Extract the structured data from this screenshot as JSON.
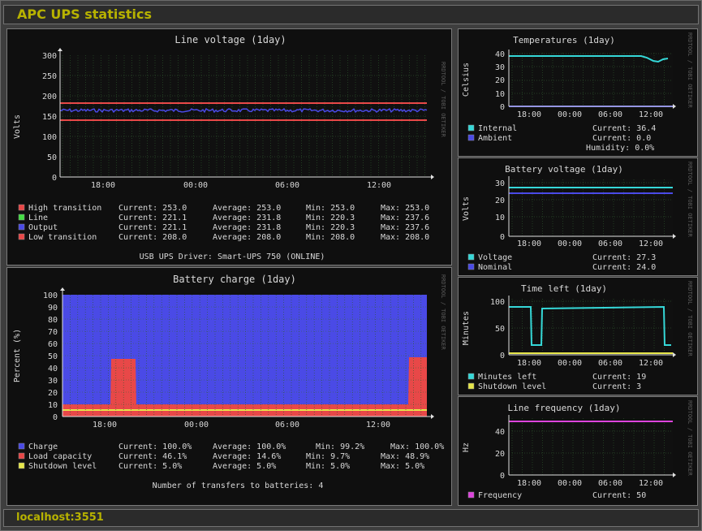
{
  "app": {
    "title": "APC UPS statistics",
    "host": "localhost:3551"
  },
  "watermark": "RRDTOOL / TOBI OETIKER",
  "colors": {
    "red": "#e84848",
    "green": "#44dd44",
    "blue": "#4a4ae6",
    "cyan": "#35d8d8",
    "yellow": "#e6e64a",
    "magenta": "#dd44dd",
    "bg": "#101010",
    "grid": "#2e5a2e"
  },
  "graphs": {
    "line_voltage": {
      "title": "Line voltage  (1day)",
      "ylabel": "Volts",
      "yticks": [
        "300",
        "250",
        "200",
        "150",
        "100",
        "50",
        "0"
      ],
      "xticks": [
        "18:00",
        "00:00",
        "06:00",
        "12:00"
      ],
      "legend": [
        {
          "name": "High transition",
          "color": "red",
          "current": "Current: 253.0",
          "average": "Average: 253.0",
          "min": "Min: 253.0",
          "max": "Max: 253.0"
        },
        {
          "name": "Line",
          "color": "green",
          "current": "Current: 221.1",
          "average": "Average: 231.8",
          "min": "Min: 220.3",
          "max": "Max: 237.6"
        },
        {
          "name": "Output",
          "color": "blue",
          "current": "Current: 221.1",
          "average": "Average: 231.8",
          "min": "Min: 220.3",
          "max": "Max: 237.6"
        },
        {
          "name": "Low transition",
          "color": "red",
          "current": "Current: 208.0",
          "average": "Average: 208.0",
          "min": "Min: 208.0",
          "max": "Max: 208.0"
        }
      ],
      "footer": "USB UPS Driver: Smart-UPS 750 (ONLINE)"
    },
    "battery_charge": {
      "title": "Battery charge  (1day)",
      "ylabel": "Percent (%)",
      "yticks": [
        "100",
        "90",
        "80",
        "70",
        "60",
        "50",
        "40",
        "30",
        "20",
        "10",
        "0"
      ],
      "xticks": [
        "18:00",
        "00:00",
        "06:00",
        "12:00"
      ],
      "legend": [
        {
          "name": "Charge",
          "color": "blue",
          "current": "Current: 100.0%",
          "average": "Average: 100.0%",
          "min": "Min: 99.2%",
          "max": "Max: 100.0%"
        },
        {
          "name": "Load capacity",
          "color": "red",
          "current": "Current: 46.1%",
          "average": "Average: 14.6%",
          "min": "Min:  9.7%",
          "max": "Max: 48.9%"
        },
        {
          "name": "Shutdown level",
          "color": "yellow",
          "current": "Current:  5.0%",
          "average": "Average:  5.0%",
          "min": "Min:  5.0%",
          "max": "Max:  5.0%"
        }
      ],
      "footer": "Number of transfers to batteries: 4"
    },
    "temperatures": {
      "title": "Temperatures  (1day)",
      "ylabel": "Celsius",
      "yticks": [
        "40",
        "30",
        "20",
        "10",
        "0"
      ],
      "xticks": [
        "18:00",
        "00:00",
        "06:00",
        "12:00"
      ],
      "legend": [
        {
          "name": "Internal",
          "color": "cyan",
          "current": "Current: 36.4"
        },
        {
          "name": "Ambient",
          "color": "blue",
          "current": "Current:  0.0"
        }
      ],
      "extra": "Humidity:  0.0%"
    },
    "battery_voltage": {
      "title": "Battery voltage  (1day)",
      "ylabel": "Volts",
      "yticks": [
        "30",
        "20",
        "10",
        "0"
      ],
      "xticks": [
        "18:00",
        "00:00",
        "06:00",
        "12:00"
      ],
      "legend": [
        {
          "name": "Voltage",
          "color": "cyan",
          "current": "Current: 27.3"
        },
        {
          "name": "Nominal",
          "color": "blue",
          "current": "Current: 24.0"
        }
      ]
    },
    "time_left": {
      "title": "Time left  (1day)",
      "ylabel": "Minutes",
      "yticks": [
        "100",
        "50",
        "0"
      ],
      "xticks": [
        "18:00",
        "00:00",
        "06:00",
        "12:00"
      ],
      "legend": [
        {
          "name": "Minutes left",
          "color": "cyan",
          "current": "Current:   19"
        },
        {
          "name": "Shutdown level",
          "color": "yellow",
          "current": "Current:    3"
        }
      ]
    },
    "line_frequency": {
      "title": "Line frequency  (1day)",
      "ylabel": "Hz",
      "yticks": [
        "40",
        "20",
        "0"
      ],
      "xticks": [
        "18:00",
        "00:00",
        "06:00",
        "12:00"
      ],
      "legend": [
        {
          "name": "Frequency",
          "color": "magenta",
          "current": "Current: 50"
        }
      ]
    }
  }
}
